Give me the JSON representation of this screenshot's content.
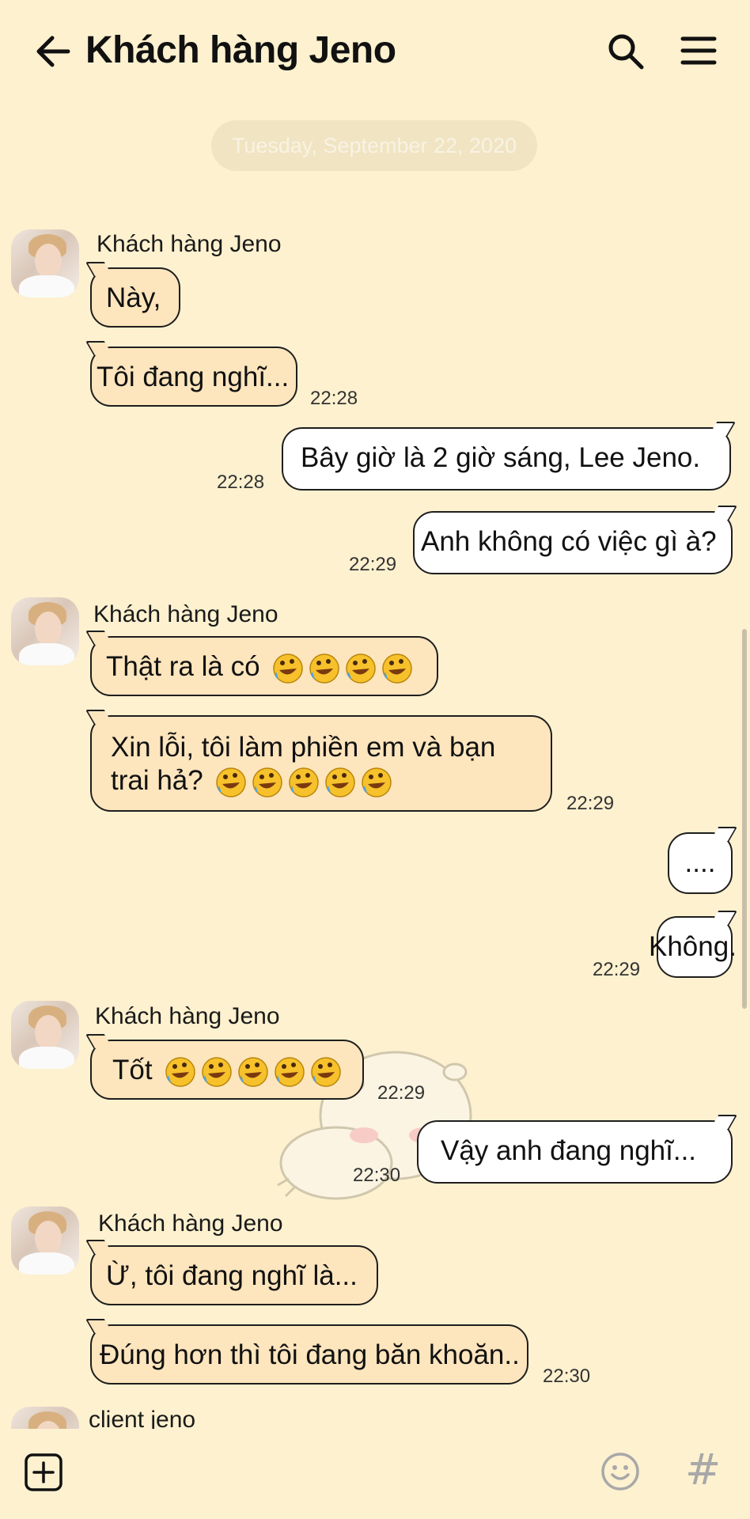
{
  "header": {
    "title": "Khách hàng Jeno"
  },
  "date_separator": "Tuesday, September 22, 2020",
  "messages": [
    {
      "name": "Khách hàng Jeno",
      "text": "Này,",
      "text2": "Tôi đang nghĩ...",
      "time": "22:28"
    },
    {
      "text": "Bây giờ là 2 giờ sáng, Lee Jeno.",
      "time": "22:28"
    },
    {
      "text": "Anh không có việc gì à?",
      "time": "22:29"
    },
    {
      "name": "Khách hàng Jeno",
      "text": "Thật ra là có",
      "text2": "Xin lỗi, tôi làm phiền em và bạn trai hả?",
      "time": "22:29"
    },
    {
      "text": "....",
      "text2": "Không.",
      "time": "22:29"
    },
    {
      "name": "Khách hàng Jeno",
      "text": "Tốt",
      "time": "22:29"
    },
    {
      "text": "Vậy anh đang nghĩ...",
      "time": "22:30"
    },
    {
      "name": "Khách hàng Jeno",
      "text": "Ừ, tôi đang nghĩ là...",
      "text2": "Đúng hơn thì tôi đang băn khoăn..",
      "time": "22:30"
    },
    {
      "name": "client jeno"
    }
  ],
  "emoji_names": [
    "rofl-emoji"
  ],
  "colors": {
    "background": "#fdf1cf",
    "incoming_bubble": "#fde5bd",
    "outgoing_bubble": "#ffffff"
  }
}
